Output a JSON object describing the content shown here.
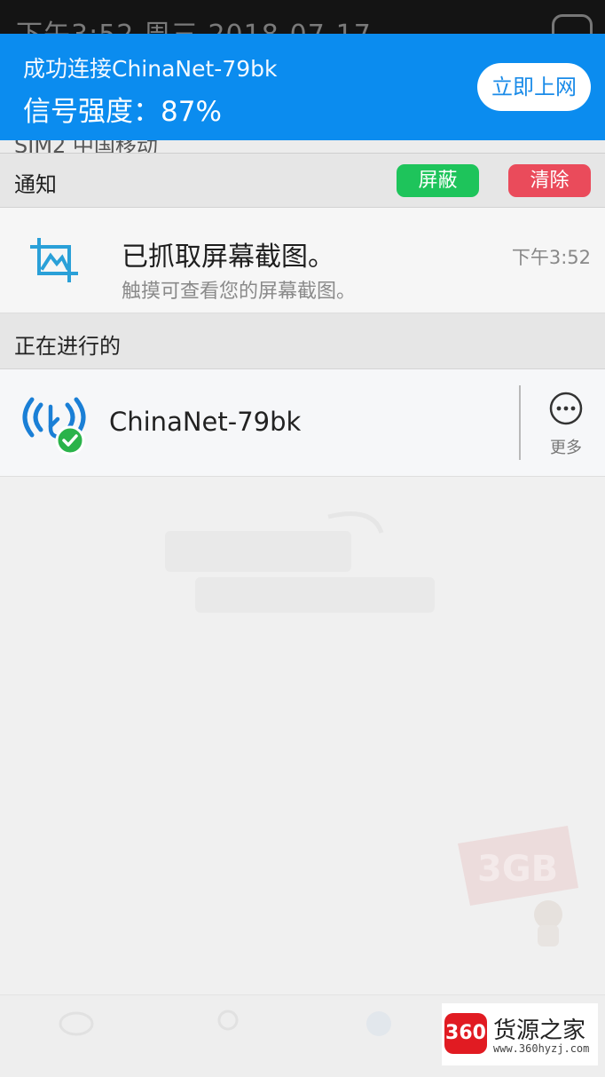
{
  "status_bar": {
    "text": "下午3:52  周三 2018-07-17"
  },
  "wifi_banner": {
    "connected_text": "成功连接ChinaNet-79bk",
    "signal_text": "信号强度：87%",
    "signal_strength_percent": 87,
    "go_online_label": "立即上网",
    "background_color": "#0b8cef"
  },
  "sim_row": {
    "text": "SIM2 中国移动"
  },
  "notifications": {
    "header_label": "通知",
    "block_label": "屏蔽",
    "clear_label": "清除",
    "block_color": "#1ec45b",
    "clear_color": "#ea4b5b",
    "items": [
      {
        "icon": "screenshot-icon",
        "title": "已抓取屏幕截图。",
        "subtitle": "触摸可查看您的屏幕截图。",
        "time": "下午3:52"
      }
    ]
  },
  "ongoing": {
    "header_label": "正在进行的",
    "items": [
      {
        "icon": "wifi-connected-icon",
        "name": "ChinaNet-79bk",
        "more_label": "更多",
        "more_icon": "more-dots-icon"
      }
    ]
  },
  "background_promo": {
    "badge_text": "3GB"
  },
  "watermark": {
    "logo_text": "360",
    "title": "货源之家",
    "url": "www.360hyzj.com"
  }
}
